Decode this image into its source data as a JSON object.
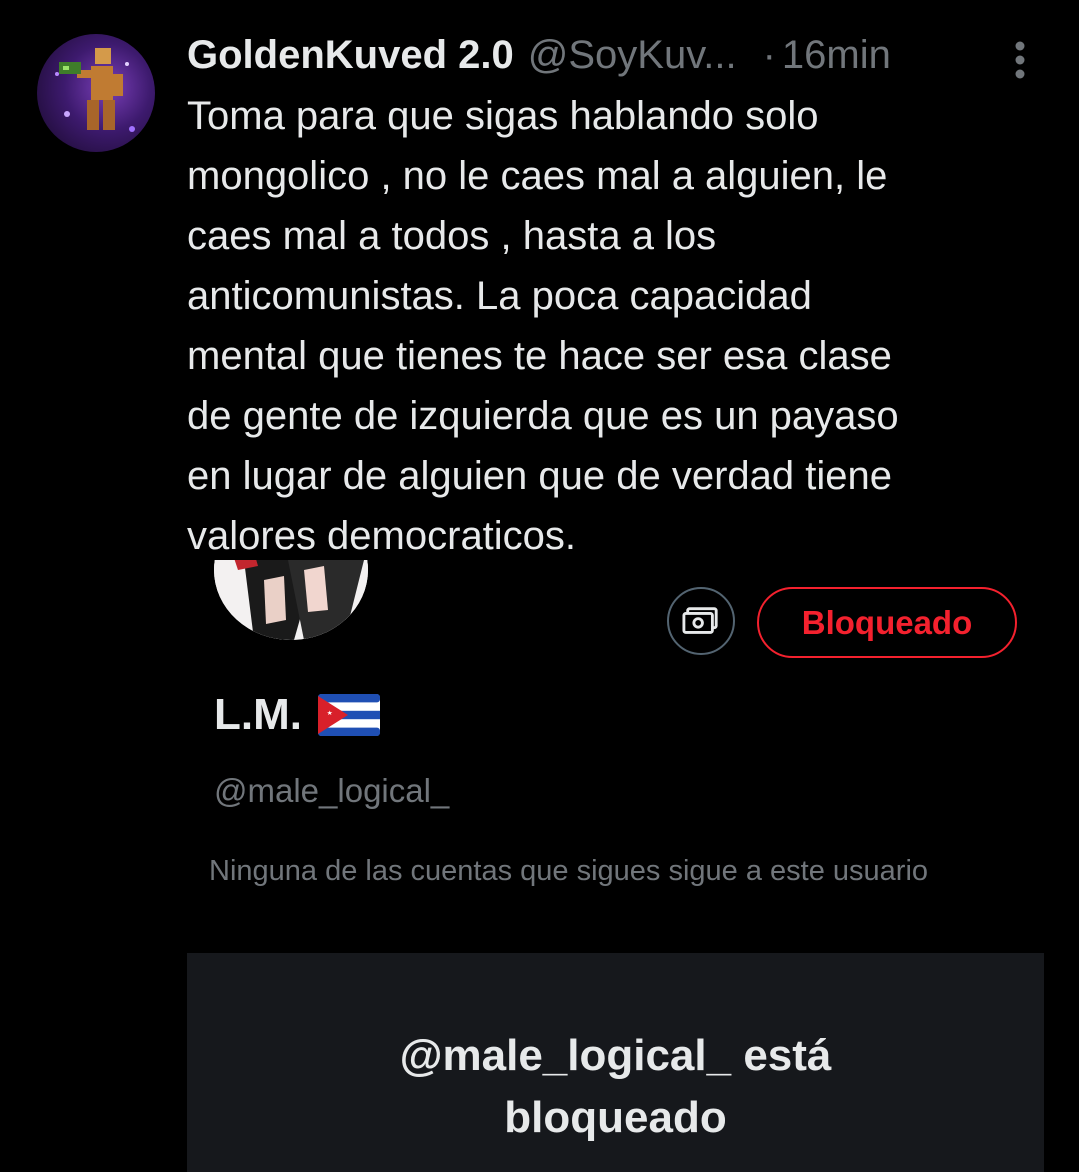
{
  "tweet": {
    "display_name": "GoldenKuved 2.0",
    "handle": "@SoyKuv...",
    "separator": "·",
    "time": "16min",
    "text": "Toma para que sigas hablando solo\nmongolico , no le caes mal a alguien, le\ncaes mal a todos , hasta a los\nanticomunistas. La poca capacidad\nmental que tienes te hace ser esa clase\nde gente de izquierda que es un payaso\nen lugar de alguien que de verdad tiene\nvalores democraticos.",
    "more_icon": "more-vertical-icon",
    "avatar_icon": "user-avatar"
  },
  "embedded_profile": {
    "blocked_button_label": "Bloqueado",
    "money_icon": "tip-money-icon",
    "name": "L.M.",
    "flag_icon": "cuba-flag-icon",
    "handle": "@male_logical_",
    "follow_info": "Ninguna de las cuentas que sigues sigue a este usuario",
    "blocked_message": "@male_logical_ está\nbloqueado"
  },
  "colors": {
    "background": "#000000",
    "text_primary": "#e7e9ea",
    "text_secondary": "#71767b",
    "danger": "#f4212e",
    "card_background": "#16181c"
  }
}
